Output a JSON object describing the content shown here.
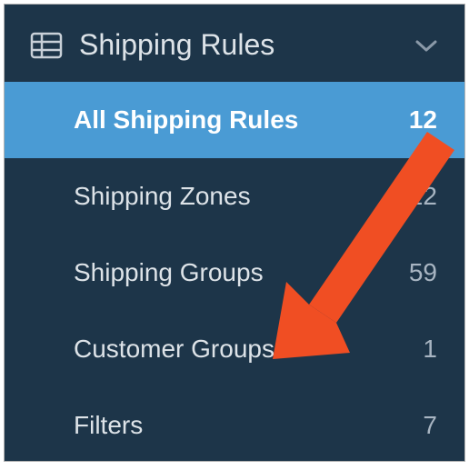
{
  "header": {
    "title": "Shipping Rules"
  },
  "nav": {
    "items": [
      {
        "label": "All Shipping Rules",
        "count": 12,
        "active": true
      },
      {
        "label": "Shipping Zones",
        "count": 22,
        "active": false
      },
      {
        "label": "Shipping Groups",
        "count": 59,
        "active": false
      },
      {
        "label": "Customer Groups",
        "count": 1,
        "active": false
      },
      {
        "label": "Filters",
        "count": 7,
        "active": false
      }
    ]
  },
  "annotation": {
    "type": "arrow",
    "color": "#f04e23",
    "points_to": "Customer Groups"
  }
}
